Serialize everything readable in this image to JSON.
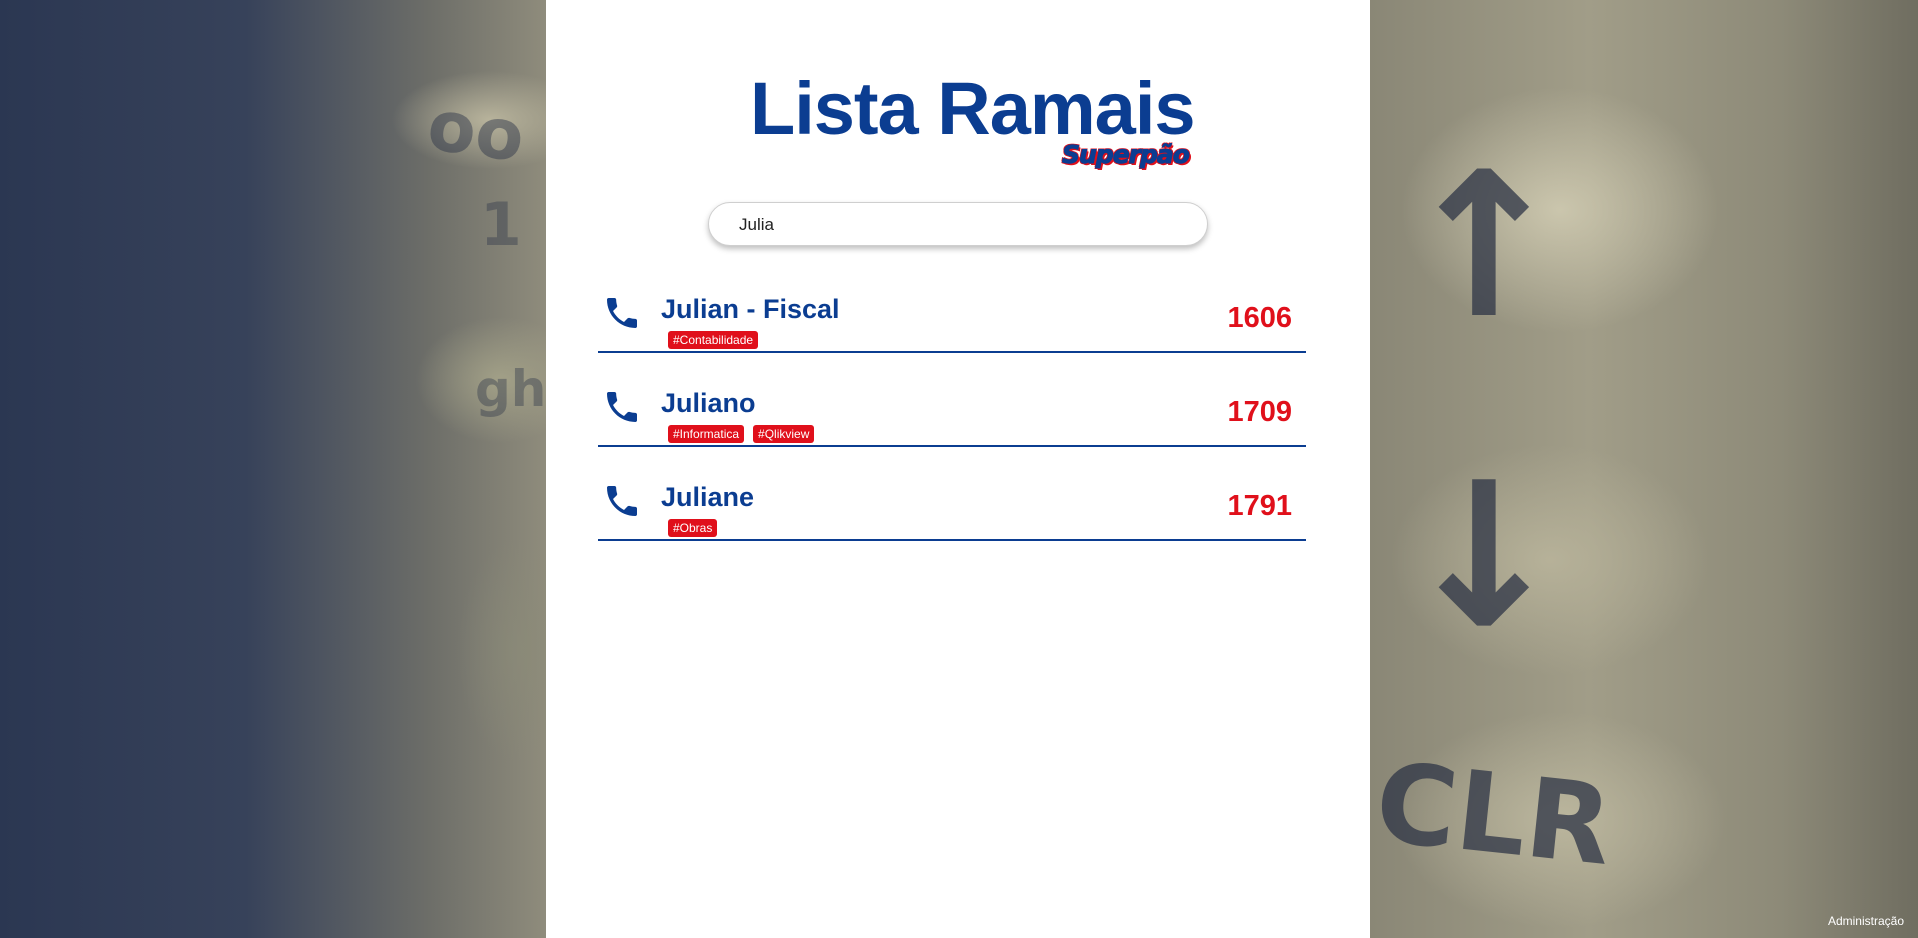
{
  "header": {
    "title": "Lista Ramais",
    "brand": "Superpão"
  },
  "search": {
    "value": "Julia",
    "placeholder": ""
  },
  "results": [
    {
      "name": "Julian - Fiscal",
      "extension": "1606",
      "tags": [
        "#Contabilidade"
      ]
    },
    {
      "name": "Juliano",
      "extension": "1709",
      "tags": [
        "#Informatica",
        "#Qlikview"
      ]
    },
    {
      "name": "Juliane",
      "extension": "1791",
      "tags": [
        "#Obras"
      ]
    }
  ],
  "footer": {
    "admin_link": "Administração"
  },
  "icons": {
    "result_icon": "phone-icon"
  },
  "colors": {
    "primary": "#0b3d91",
    "accent": "#e0101b",
    "panel": "#ffffff"
  }
}
